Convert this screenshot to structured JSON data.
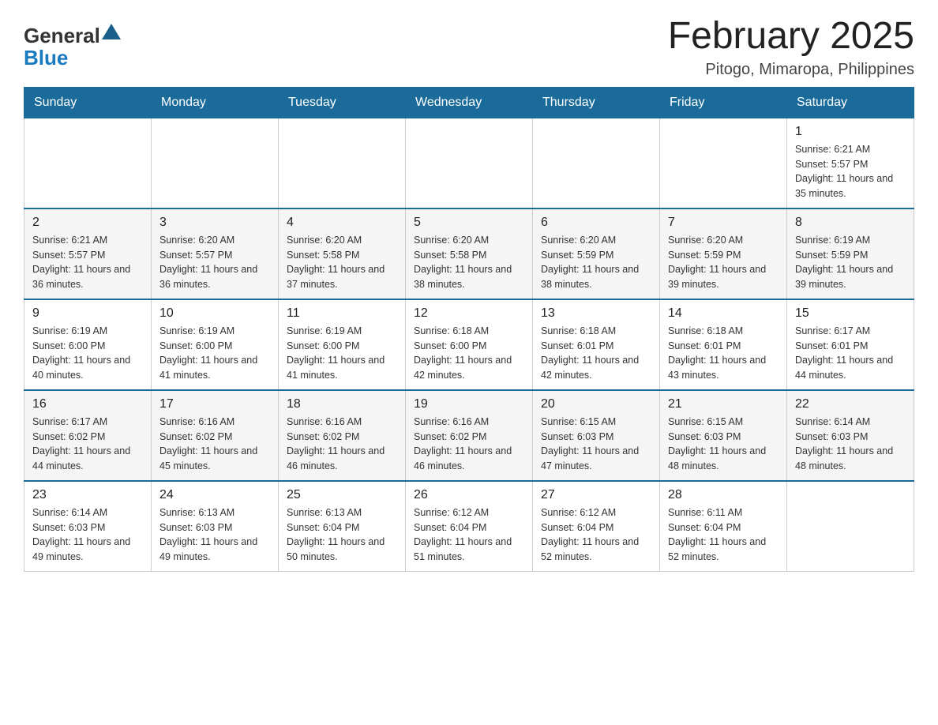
{
  "header": {
    "logo_general": "General",
    "logo_blue": "Blue",
    "title": "February 2025",
    "location": "Pitogo, Mimaropa, Philippines"
  },
  "days_of_week": [
    "Sunday",
    "Monday",
    "Tuesday",
    "Wednesday",
    "Thursday",
    "Friday",
    "Saturday"
  ],
  "weeks": [
    {
      "days": [
        {
          "number": "",
          "info": ""
        },
        {
          "number": "",
          "info": ""
        },
        {
          "number": "",
          "info": ""
        },
        {
          "number": "",
          "info": ""
        },
        {
          "number": "",
          "info": ""
        },
        {
          "number": "",
          "info": ""
        },
        {
          "number": "1",
          "info": "Sunrise: 6:21 AM\nSunset: 5:57 PM\nDaylight: 11 hours and 35 minutes."
        }
      ]
    },
    {
      "days": [
        {
          "number": "2",
          "info": "Sunrise: 6:21 AM\nSunset: 5:57 PM\nDaylight: 11 hours and 36 minutes."
        },
        {
          "number": "3",
          "info": "Sunrise: 6:20 AM\nSunset: 5:57 PM\nDaylight: 11 hours and 36 minutes."
        },
        {
          "number": "4",
          "info": "Sunrise: 6:20 AM\nSunset: 5:58 PM\nDaylight: 11 hours and 37 minutes."
        },
        {
          "number": "5",
          "info": "Sunrise: 6:20 AM\nSunset: 5:58 PM\nDaylight: 11 hours and 38 minutes."
        },
        {
          "number": "6",
          "info": "Sunrise: 6:20 AM\nSunset: 5:59 PM\nDaylight: 11 hours and 38 minutes."
        },
        {
          "number": "7",
          "info": "Sunrise: 6:20 AM\nSunset: 5:59 PM\nDaylight: 11 hours and 39 minutes."
        },
        {
          "number": "8",
          "info": "Sunrise: 6:19 AM\nSunset: 5:59 PM\nDaylight: 11 hours and 39 minutes."
        }
      ]
    },
    {
      "days": [
        {
          "number": "9",
          "info": "Sunrise: 6:19 AM\nSunset: 6:00 PM\nDaylight: 11 hours and 40 minutes."
        },
        {
          "number": "10",
          "info": "Sunrise: 6:19 AM\nSunset: 6:00 PM\nDaylight: 11 hours and 41 minutes."
        },
        {
          "number": "11",
          "info": "Sunrise: 6:19 AM\nSunset: 6:00 PM\nDaylight: 11 hours and 41 minutes."
        },
        {
          "number": "12",
          "info": "Sunrise: 6:18 AM\nSunset: 6:00 PM\nDaylight: 11 hours and 42 minutes."
        },
        {
          "number": "13",
          "info": "Sunrise: 6:18 AM\nSunset: 6:01 PM\nDaylight: 11 hours and 42 minutes."
        },
        {
          "number": "14",
          "info": "Sunrise: 6:18 AM\nSunset: 6:01 PM\nDaylight: 11 hours and 43 minutes."
        },
        {
          "number": "15",
          "info": "Sunrise: 6:17 AM\nSunset: 6:01 PM\nDaylight: 11 hours and 44 minutes."
        }
      ]
    },
    {
      "days": [
        {
          "number": "16",
          "info": "Sunrise: 6:17 AM\nSunset: 6:02 PM\nDaylight: 11 hours and 44 minutes."
        },
        {
          "number": "17",
          "info": "Sunrise: 6:16 AM\nSunset: 6:02 PM\nDaylight: 11 hours and 45 minutes."
        },
        {
          "number": "18",
          "info": "Sunrise: 6:16 AM\nSunset: 6:02 PM\nDaylight: 11 hours and 46 minutes."
        },
        {
          "number": "19",
          "info": "Sunrise: 6:16 AM\nSunset: 6:02 PM\nDaylight: 11 hours and 46 minutes."
        },
        {
          "number": "20",
          "info": "Sunrise: 6:15 AM\nSunset: 6:03 PM\nDaylight: 11 hours and 47 minutes."
        },
        {
          "number": "21",
          "info": "Sunrise: 6:15 AM\nSunset: 6:03 PM\nDaylight: 11 hours and 48 minutes."
        },
        {
          "number": "22",
          "info": "Sunrise: 6:14 AM\nSunset: 6:03 PM\nDaylight: 11 hours and 48 minutes."
        }
      ]
    },
    {
      "days": [
        {
          "number": "23",
          "info": "Sunrise: 6:14 AM\nSunset: 6:03 PM\nDaylight: 11 hours and 49 minutes."
        },
        {
          "number": "24",
          "info": "Sunrise: 6:13 AM\nSunset: 6:03 PM\nDaylight: 11 hours and 49 minutes."
        },
        {
          "number": "25",
          "info": "Sunrise: 6:13 AM\nSunset: 6:04 PM\nDaylight: 11 hours and 50 minutes."
        },
        {
          "number": "26",
          "info": "Sunrise: 6:12 AM\nSunset: 6:04 PM\nDaylight: 11 hours and 51 minutes."
        },
        {
          "number": "27",
          "info": "Sunrise: 6:12 AM\nSunset: 6:04 PM\nDaylight: 11 hours and 52 minutes."
        },
        {
          "number": "28",
          "info": "Sunrise: 6:11 AM\nSunset: 6:04 PM\nDaylight: 11 hours and 52 minutes."
        },
        {
          "number": "",
          "info": ""
        }
      ]
    }
  ]
}
